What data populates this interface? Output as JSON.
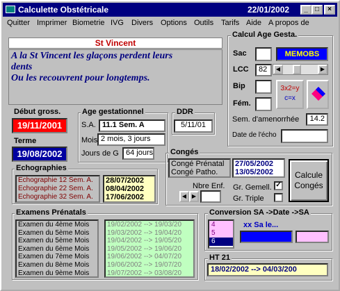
{
  "window": {
    "title": "Calculette Obstétricale",
    "date": "22/01/2002",
    "min": "_",
    "max": "□",
    "close": "×"
  },
  "menu": [
    "Quitter",
    "Imprimer",
    "Biometrie",
    "IVG",
    "Divers",
    "Options",
    "Outils",
    "Tarifs",
    "Aide",
    "A propos de"
  ],
  "saint": {
    "name": "St Vincent",
    "line1": "A la St Vincent les glaçons perdent leurs",
    "line2": "dents",
    "line3": "Ou les recouvrent pour longtemps."
  },
  "calcul": {
    "title": "Calcul Age Gesta.",
    "sac": "Sac",
    "memobs": "MEMOBS",
    "lcc": "LCC",
    "lcc_value": "82",
    "bip": "Bip",
    "fem": "Fém.",
    "formula1": "3x2=y",
    "formula2": "c=x",
    "sem_label": "Sem. d'amenorrhée",
    "sem_value": "14.2",
    "echo_label": "Date de l'écho"
  },
  "debut": {
    "title": "Début gross.",
    "value": "19/11/2001"
  },
  "terme": {
    "title": "Terme",
    "value": "19/08/2002"
  },
  "age": {
    "title": "Age gestationnel",
    "sa_label": "S.A.",
    "sa_value": "11.1  Sem. A",
    "mois_label": "Mois",
    "mois_value": "2 mois, 3 jours",
    "jours_label": "Jours de G",
    "jours_value": "64 jours"
  },
  "ddr": {
    "title": "DDR",
    "value": "5/11/01"
  },
  "echographies": {
    "title": "Echographies",
    "items": [
      "Echographie 12 Sem. A.",
      "Echographie 22 Sem. A.",
      "Echographie 32 Sem. A."
    ],
    "dates": [
      "28/07/2002",
      "08/04/2002",
      "17/06/2002"
    ]
  },
  "conges": {
    "title": "Congés",
    "labels": [
      "Congé Prénatal",
      "Congé Patho."
    ],
    "dates": [
      "27/05/2002",
      "13/05/2002"
    ],
    "nbre": "Nbre Enf.",
    "gemell": "Gr. Gemell.",
    "triple": "Gr. Triple",
    "button": "Calcule Congés",
    "check": "✓"
  },
  "examens": {
    "title": "Examens Prénatals",
    "items": [
      "Examen du 4ème Mois",
      "Examen du 5ème Mois",
      "Examen du 5ème Mois",
      "Examen du 6ème Mois",
      "Examen du 7ème Mois",
      "Examen du 8ème Mois",
      "Examen du 9ème Mois"
    ],
    "ranges": [
      "19/02/2002 --> 19/03/20",
      "19/03/2002 --> 19/04/20",
      "19/04/2002 --> 19/05/20",
      "19/05/2002 --> 19/06/20",
      "19/06/2002 --> 04/07/20",
      "19/06/2002 --> 19/07/20",
      "19/07/2002 --> 03/08/20"
    ]
  },
  "conversion": {
    "title": "Conversion  SA ->Date ->SA",
    "options": [
      "4",
      "5",
      "6"
    ],
    "text": "xx Sa le..."
  },
  "ht21": {
    "title": "HT 21",
    "value": "18/02/2002    -->    04/03/200"
  }
}
